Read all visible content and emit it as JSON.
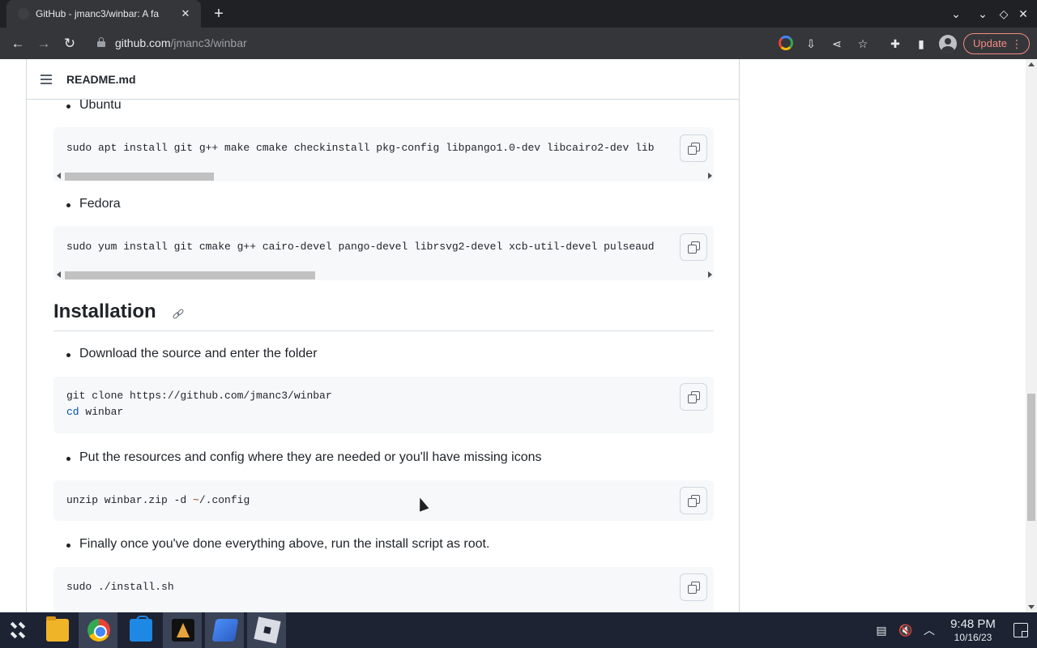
{
  "browser": {
    "tab_title": "GitHub - jmanc3/winbar: A fa",
    "url_domain": "github.com",
    "url_path": "/jmanc3/winbar",
    "update_label": "Update"
  },
  "readme": {
    "file_name": "README.md",
    "items": [
      {
        "bullet": "Ubuntu",
        "code": "sudo apt install git g++ make cmake checkinstall pkg-config libpango1.0-dev libcairo2-dev lib"
      },
      {
        "bullet": "Fedora",
        "code": "sudo yum install git cmake g++ cairo-devel pango-devel librsvg2-devel xcb-util-devel pulseaud"
      }
    ],
    "installation": {
      "heading": "Installation",
      "steps": [
        {
          "bullet": "Download the source and enter the folder",
          "code_line1": "git clone https://github.com/jmanc3/winbar",
          "code_line2_kw": "cd",
          "code_line2_rest": " winbar"
        },
        {
          "bullet": "Put the resources and config where they are needed or you'll have missing icons",
          "code_pre": "unzip winbar.zip -d ",
          "code_op": "~",
          "code_post": "/.config"
        },
        {
          "bullet": "Finally once you've done everything above, run the install script as root.",
          "code": "sudo ./install.sh"
        }
      ]
    }
  },
  "taskbar": {
    "time": "9:48 PM",
    "date": "10/16/23",
    "apps": [
      "launcher-icon",
      "files-icon",
      "chrome-icon",
      "store-icon",
      "kicad-icon",
      "virtualbox-icon",
      "roblox-icon"
    ]
  }
}
